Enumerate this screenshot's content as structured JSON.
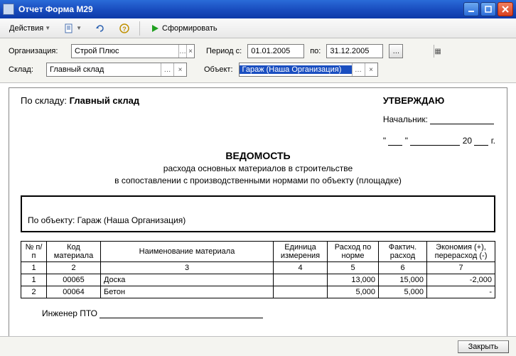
{
  "window": {
    "title": "Отчет  Форма М29"
  },
  "toolbar": {
    "actions_label": "Действия",
    "generate_label": "Сформировать"
  },
  "params": {
    "org_label": "Организация:",
    "org_value": "Строй Плюс",
    "period_label": "Период с:",
    "period_from": "01.01.2005",
    "period_to_label": "по:",
    "period_to": "31.12.2005",
    "warehouse_label": "Склад:",
    "warehouse_value": "Главный склад",
    "object_label": "Объект:",
    "object_value": "Гараж (Наша Организация)"
  },
  "report": {
    "by_warehouse_label": "По складу:",
    "by_warehouse_value": "Главный склад",
    "approve": "УТВЕРЖДАЮ",
    "chief_label": "Начальник:",
    "year_suffix_prefix": "20",
    "year_suffix_suffix": "г.",
    "title": "ВЕДОМОСТЬ",
    "subtitle1": "расхода основных материалов в строительстве",
    "subtitle2": "в сопоставлении с производственными нормами по объекту (площадке)",
    "by_object_label": "По объекту:",
    "by_object_value": "Гараж (Наша Организация)",
    "headers": {
      "num": "№ п/п",
      "code": "Код материала",
      "name": "Наименование материала",
      "unit": "Единица измерения",
      "norm": "Расход по норме",
      "fact": "Фактич. расход",
      "econ": "Экономия (+), перерасход (-)"
    },
    "col_nums": {
      "c1": "1",
      "c2": "2",
      "c3": "3",
      "c4": "4",
      "c5": "5",
      "c6": "6",
      "c7": "7"
    },
    "rows": [
      {
        "n": "1",
        "code": "00065",
        "name": "Доска",
        "unit": "",
        "norm": "13,000",
        "fact": "15,000",
        "econ": "-2,000"
      },
      {
        "n": "2",
        "code": "00064",
        "name": "Бетон",
        "unit": "",
        "norm": "5,000",
        "fact": "5,000",
        "econ": "-"
      }
    ],
    "engineer_label": "Инженер ПТО"
  },
  "footer": {
    "close_label": "Закрыть"
  }
}
